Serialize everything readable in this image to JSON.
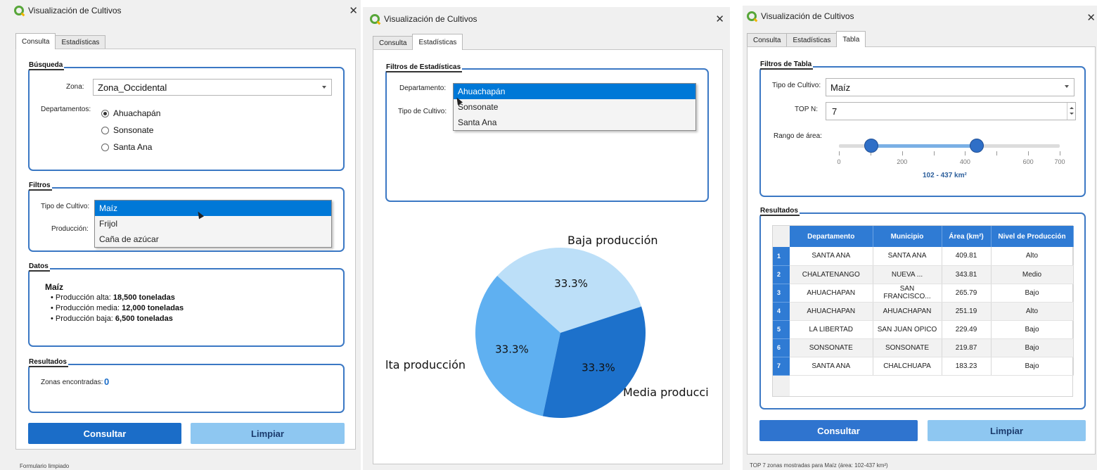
{
  "window1": {
    "title": "Visualización de Cultivos",
    "tabs": [
      "Consulta",
      "Estadísticas"
    ],
    "busqueda": {
      "group_title": "Búsqueda",
      "zona_label": "Zona:",
      "zona_value": "Zona_Occidental",
      "departamentos_label": "Departamentos:",
      "options": [
        "Ahuachapán",
        "Sonsonate",
        "Santa Ana"
      ],
      "selected": "Ahuachapán"
    },
    "filtros": {
      "group_title": "Filtros",
      "tipo_label": "Tipo de Cultivo:",
      "produccion_label": "Producción:",
      "dropdown_items": [
        "Maíz",
        "Frijol",
        "Caña de azúcar"
      ],
      "dropdown_selected": "Maíz"
    },
    "datos": {
      "group_title": "Datos",
      "crop": "Maíz",
      "items": [
        {
          "label": "Producción alta: ",
          "value": "18,500 toneladas"
        },
        {
          "label": "Producción media: ",
          "value": "12,000 toneladas"
        },
        {
          "label": "Producción baja: ",
          "value": "6,500 toneladas"
        }
      ]
    },
    "resultados": {
      "group_title": "Resultados",
      "zonas_label": "Zonas encontradas:",
      "zonas_value": "0"
    },
    "buttons": {
      "consultar": "Consultar",
      "limpiar": "Limpiar"
    },
    "status": "Formulario limpiado"
  },
  "window2": {
    "title": "Visualización de Cultivos",
    "tabs": [
      "Consulta",
      "Estadísticas"
    ],
    "filtros": {
      "group_title": "Filtros de Estadísticas",
      "departamento_label": "Departamento:",
      "tipo_label": "Tipo de Cultivo:",
      "dropdown_items": [
        "Ahuachapán",
        "Sonsonate",
        "Santa Ana"
      ],
      "dropdown_selected": "Ahuachapán"
    }
  },
  "window3": {
    "title": "Visualización de Cultivos",
    "tabs": [
      "Consulta",
      "Estadísticas",
      "Tabla"
    ],
    "filtros": {
      "group_title": "Filtros de Tabla",
      "tipo_label": "Tipo de Cultivo:",
      "tipo_value": "Maíz",
      "top_label": "TOP N:",
      "top_value": "7",
      "rango_label": "Rango de área:",
      "slider": {
        "min": 0,
        "max": 700,
        "low": 102,
        "high": 437,
        "tick_labels": [
          "0",
          "200",
          "400",
          "600",
          "700"
        ],
        "tick_values": [
          0,
          200,
          400,
          600,
          700
        ],
        "minor_ticks": [
          100,
          300,
          500
        ],
        "range_text": "102 - 437 km²"
      }
    },
    "resultados": {
      "group_title": "Resultados",
      "columns": [
        "Departamento",
        "Municipio",
        "Área (km²)",
        "Nivel de Producción"
      ],
      "rows": [
        [
          "SANTA ANA",
          "SANTA ANA",
          "409.81",
          "Alto"
        ],
        [
          "CHALATENANGO",
          "NUEVA ...",
          "343.81",
          "Medio"
        ],
        [
          "AHUACHAPAN",
          "SAN FRANCISCO...",
          "265.79",
          "Bajo"
        ],
        [
          "AHUACHAPAN",
          "AHUACHAPAN",
          "251.19",
          "Alto"
        ],
        [
          "LA LIBERTAD",
          "SAN JUAN OPICO",
          "229.49",
          "Bajo"
        ],
        [
          "SONSONATE",
          "SONSONATE",
          "219.87",
          "Bajo"
        ],
        [
          "SANTA ANA",
          "CHALCHUAPA",
          "183.23",
          "Bajo"
        ]
      ],
      "row_numbers": [
        "1",
        "2",
        "3",
        "4",
        "5",
        "6",
        "7"
      ]
    },
    "buttons": {
      "consultar": "Consultar",
      "limpiar": "Limpiar"
    },
    "status": "TOP 7 zonas mostradas para Maíz (área: 102-437 km²)"
  },
  "chart_data": {
    "type": "pie",
    "categories": [
      "Baja producción",
      "Media producción",
      "Alta producción"
    ],
    "values": [
      33.3,
      33.3,
      33.3
    ],
    "labels_shown": [
      "Baja producción",
      "Media producci",
      "lta producción"
    ],
    "pct_labels": [
      "33.3%",
      "33.3%",
      "33.3%"
    ],
    "colors": [
      "#bcdff8",
      "#5fb0f1",
      "#1d71cb"
    ],
    "start_angle_deg": 18
  },
  "colors": {
    "accent": "#3b78c4",
    "primary_button": "#1b6dc8",
    "secondary_button": "#8ec7f1",
    "selection": "#0078d7"
  }
}
